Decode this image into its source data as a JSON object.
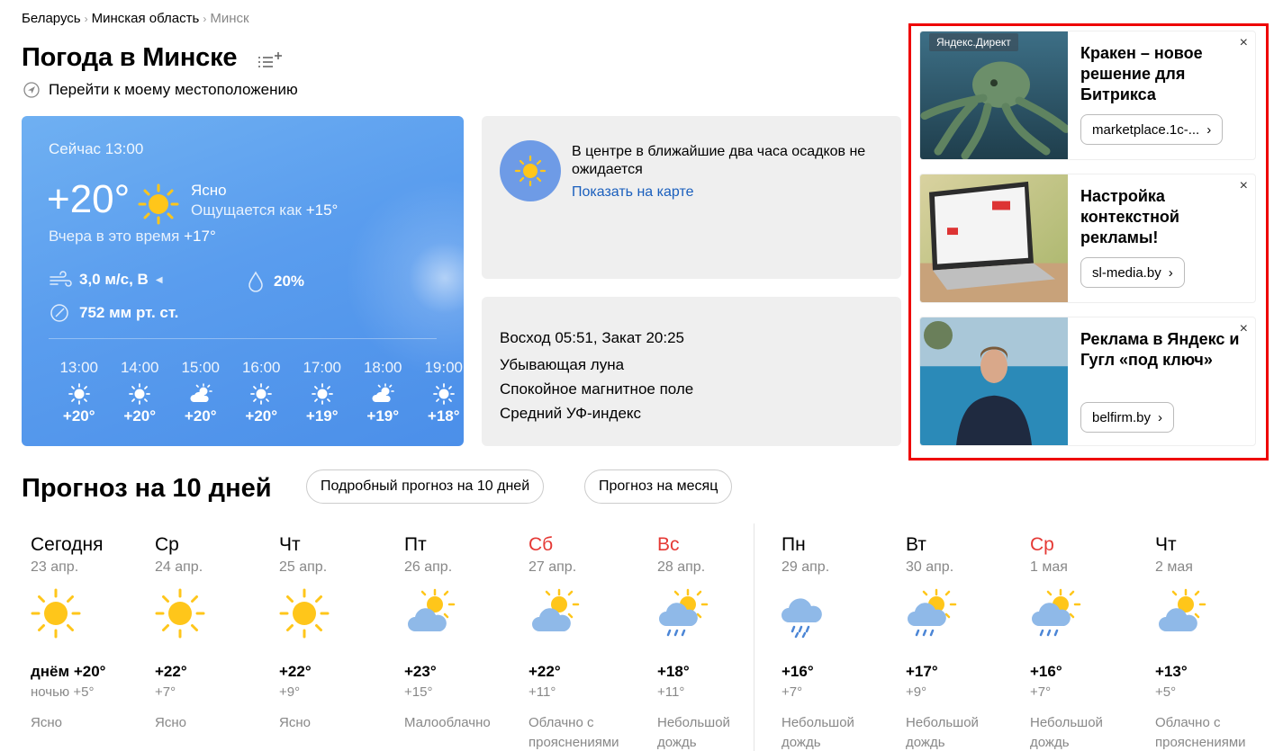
{
  "breadcrumbs": [
    "Беларусь",
    "Минская область",
    "Минск"
  ],
  "title": "Погода в Минске",
  "geo_link": "Перейти к моему местоположению",
  "now": {
    "time": "Сейчас 13:00",
    "temp": "+20°",
    "condition": "Ясно",
    "feels_label": "Ощущается как ",
    "feels_value": "+15°",
    "yesterday_label": "Вчера в это время ",
    "yesterday_value": "+17°",
    "wind": "3,0 м/с, В",
    "humidity": "20%",
    "pressure": "752 мм рт. ст."
  },
  "hourly": [
    {
      "time": "13:00",
      "icon": "sun-icon",
      "temp": "+20°"
    },
    {
      "time": "14:00",
      "icon": "sun-icon",
      "temp": "+20°"
    },
    {
      "time": "15:00",
      "icon": "sun-cloud-icon",
      "temp": "+20°"
    },
    {
      "time": "16:00",
      "icon": "sun-icon",
      "temp": "+20°"
    },
    {
      "time": "17:00",
      "icon": "sun-icon",
      "temp": "+19°"
    },
    {
      "time": "18:00",
      "icon": "sun-cloud-icon",
      "temp": "+19°"
    },
    {
      "time": "19:00",
      "icon": "sun-icon",
      "temp": "+18°"
    }
  ],
  "precip": {
    "text": "В центре в ближайшие два часа осадков не ожидается",
    "link": "Показать на карте"
  },
  "astro": {
    "sun": "Восход 05:51, Закат 20:25",
    "moon": "Убывающая луна",
    "magnetic": "Спокойное магнитное поле",
    "uv": "Средний УФ-индекс"
  },
  "ads": [
    {
      "label": "Яндекс.Директ",
      "title": "Кракен – новое решение для Битрикса",
      "button": "marketplace.1c-...",
      "close": "×"
    },
    {
      "title": "Настройка контекстной рекламы!",
      "button": "sl-media.by",
      "close": "×"
    },
    {
      "title": "Реклама в Яндекс и Гугл «под ключ»",
      "button": "belfirm.by",
      "close": "×"
    }
  ],
  "forecast": {
    "title": "Прогноз на 10 дней",
    "detailed_button": "Подробный прогноз на 10 дней",
    "month_button": "Прогноз на месяц",
    "days": [
      {
        "name": "Сегодня",
        "date": "23 апр.",
        "icon": "sun-icon",
        "hi": "днём +20°",
        "lo": "ночью +5°",
        "cond": "Ясно",
        "weekend": false
      },
      {
        "name": "Ср",
        "date": "24 апр.",
        "icon": "sun-icon",
        "hi": "+22°",
        "lo": "+7°",
        "cond": "Ясно",
        "weekend": false
      },
      {
        "name": "Чт",
        "date": "25 апр.",
        "icon": "sun-icon",
        "hi": "+22°",
        "lo": "+9°",
        "cond": "Ясно",
        "weekend": false
      },
      {
        "name": "Пт",
        "date": "26 апр.",
        "icon": "sun-cloud-icon",
        "hi": "+23°",
        "lo": "+15°",
        "cond": "Малооблачно",
        "weekend": false
      },
      {
        "name": "Сб",
        "date": "27 апр.",
        "icon": "sun-cloud-icon",
        "hi": "+22°",
        "lo": "+11°",
        "cond": "Облачно с прояснениями",
        "weekend": true
      },
      {
        "name": "Вс",
        "date": "28 апр.",
        "icon": "sun-cloud-rain-icon",
        "hi": "+18°",
        "lo": "+11°",
        "cond": "Небольшой дождь",
        "weekend": true
      },
      {
        "name": "Пн",
        "date": "29 апр.",
        "icon": "cloud-rain-icon",
        "hi": "+16°",
        "lo": "+7°",
        "cond": "Небольшой дождь",
        "weekend": false
      },
      {
        "name": "Вт",
        "date": "30 апр.",
        "icon": "sun-cloud-rain-icon",
        "hi": "+17°",
        "lo": "+9°",
        "cond": "Небольшой дождь",
        "weekend": false
      },
      {
        "name": "Ср",
        "date": "1 мая",
        "icon": "sun-cloud-rain-icon",
        "hi": "+16°",
        "lo": "+7°",
        "cond": "Небольшой дождь",
        "weekend": true
      },
      {
        "name": "Чт",
        "date": "2 мая",
        "icon": "sun-cloud-icon",
        "hi": "+13°",
        "lo": "+5°",
        "cond": "Облачно с прояснениями",
        "weekend": false
      }
    ]
  },
  "colors": {
    "accent_link": "#1a5fbd",
    "weekend": "#e53935",
    "sun": "#ffc61a",
    "card_blue": "#5a9dee",
    "ad_frame": "#e00000"
  }
}
